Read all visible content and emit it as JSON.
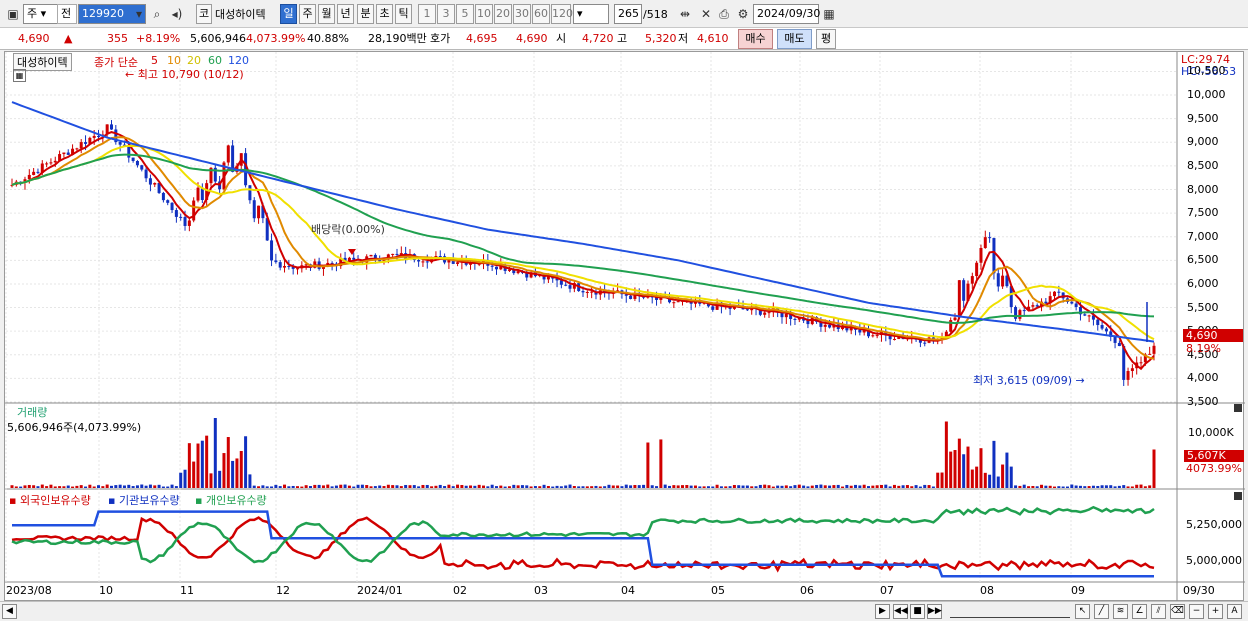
{
  "toolbar": {
    "type_label": "주",
    "all_label": "전",
    "code": "129920",
    "stock_name": "대성하이텍",
    "code_label": "코",
    "periods": [
      "일",
      "주",
      "월",
      "년",
      "분",
      "초",
      "틱"
    ],
    "intervals": [
      "1",
      "3",
      "5",
      "10",
      "20",
      "30",
      "60",
      "120"
    ],
    "count": "265",
    "total": "/518",
    "date": "2024/09/30"
  },
  "quote": {
    "price": "4,690",
    "arrow": "▲",
    "change": "355",
    "change_pct": "+8.19%",
    "volume": "5,606,946",
    "volume_pct": "4,073.99%",
    "turnover_pct": "40.88%",
    "amount": "28,190백만",
    "ask_label": "호가",
    "ask1": "4,695",
    "ask2": "4,690",
    "open_label": "시",
    "open": "4,720",
    "high_label": "고",
    "high": "5,320",
    "low_label": "저",
    "low": "4,610",
    "buy_label": "매수",
    "sell_label": "매도",
    "eval_label": "평"
  },
  "price_pane": {
    "name_tag": "대성하이텍",
    "legend_prefix": "종가 단순",
    "ma_labels": [
      "5",
      "10",
      "20",
      "60",
      "120"
    ],
    "ma_colors": [
      "#d00000",
      "#e08a00",
      "#f0e000",
      "#20a050",
      "#2050e0"
    ],
    "lc": "LC:29.74",
    "hc": "HC:-56.53",
    "high_note": "최고 10,790 (10/12)",
    "low_note": "최저 3,615 (09/09)",
    "dividend_note": "배당락(0.00%)",
    "y_ticks": [
      "10,500",
      "10,000",
      "9,500",
      "9,000",
      "8,500",
      "8,000",
      "7,500",
      "7,000",
      "6,500",
      "6,000",
      "5,500",
      "5,000",
      "4,500",
      "4,000",
      "3,500"
    ],
    "current_price_tag": "4,690",
    "current_pct_tag": "8.19%"
  },
  "volume_pane": {
    "title": "거래량",
    "value": "5,606,946주(4,073.99%)",
    "y_tick": "10,000K",
    "current_tag": "5,607K",
    "current_pct": "4073.99%"
  },
  "holder_pane": {
    "legend": [
      "외국인보유수량",
      "기관보유수량",
      "개인보유수량"
    ],
    "legend_colors": [
      "#d00000",
      "#2050e0",
      "#20a050"
    ],
    "y_ticks": [
      "5,250,000",
      "5,000,000"
    ]
  },
  "x_axis": [
    "2023/08",
    "10",
    "11",
    "12",
    "2024/01",
    "02",
    "03",
    "04",
    "05",
    "06",
    "07",
    "08",
    "09",
    "09/30"
  ],
  "chart_data": [
    {
      "type": "line",
      "title": "",
      "x": [
        "2023/08",
        "10",
        "11",
        "12",
        "2024/01",
        "02",
        "03",
        "04",
        "05",
        "06",
        "07",
        "08",
        "09"
      ],
      "series": [
        {
          "name": "5",
          "values": [
            8100,
            9300,
            6800,
            6350,
            6600,
            6450,
            5900,
            5600,
            5400,
            4950,
            4750,
            5800,
            4150
          ]
        },
        {
          "name": "120",
          "values": [
            9850,
            9100,
            8600,
            8100,
            7600,
            7150,
            6850,
            6500,
            6050,
            5600,
            5300,
            5050,
            4780
          ]
        }
      ],
      "ylim": [
        3500,
        10700
      ]
    }
  ]
}
